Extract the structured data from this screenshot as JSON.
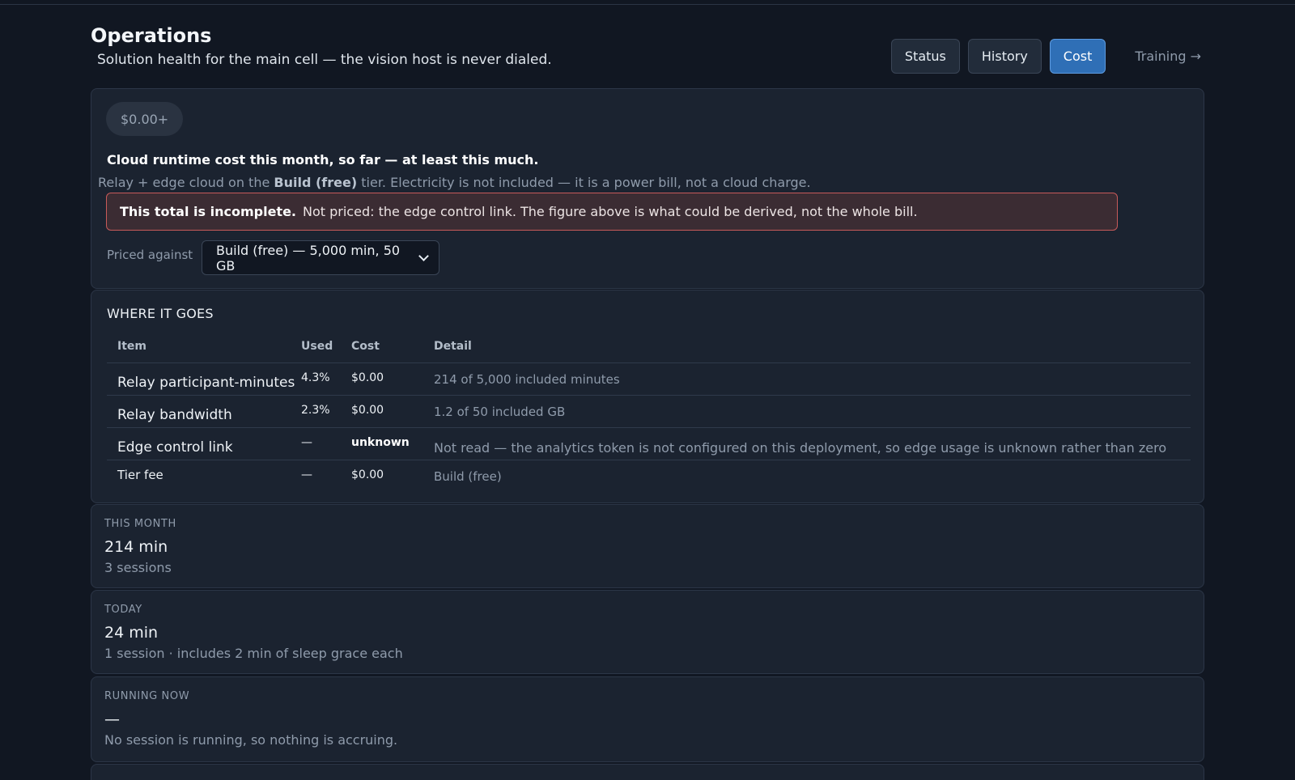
{
  "header": {
    "title": "Operations",
    "subtitle": "Solution health for the main cell — the vision host is never dialed.",
    "tabs": [
      {
        "label": "Status",
        "active": false
      },
      {
        "label": "History",
        "active": false
      },
      {
        "label": "Cost",
        "active": true
      }
    ],
    "training_link": "Training →"
  },
  "cost": {
    "badge": "$0.00+",
    "heading": "Cloud runtime cost this month, so far — at least this much.",
    "desc_prefix": "Relay + edge cloud on the ",
    "desc_tier": "Build (free)",
    "desc_suffix": " tier. Electricity is not included — it is a power bill, not a cloud charge.",
    "warning_title": "This total is incomplete.",
    "warning_text": "Not priced: the edge control link. The figure above is what could be derived, not the whole bill.",
    "priced_against_label": "Priced against",
    "priced_against_value": "Build (free) — 5,000 min, 50 GB"
  },
  "where": {
    "title": "WHERE IT GOES",
    "columns": [
      "Item",
      "Used",
      "Cost",
      "Detail"
    ],
    "rows": [
      {
        "item": "Relay participant-minutes",
        "used": "4.3%",
        "cost": "$0.00",
        "detail": "214 of 5,000 included minutes"
      },
      {
        "item": "Relay bandwidth",
        "used": "2.3%",
        "cost": "$0.00",
        "detail": "1.2 of 50 included GB"
      },
      {
        "item": "Edge control link",
        "used": "—",
        "cost": "unknown",
        "detail": "Not read — the analytics token is not configured on this deployment, so edge usage is unknown rather than zero"
      },
      {
        "item": "Tier fee",
        "used": "—",
        "cost": "$0.00",
        "detail": "Build (free)"
      }
    ]
  },
  "stats": {
    "month": {
      "label": "THIS MONTH",
      "value": "214 min",
      "sub": "3 sessions"
    },
    "today": {
      "label": "TODAY",
      "value": "24 min",
      "sub": "1 session · includes 2 min of sleep grace each"
    },
    "running": {
      "label": "RUNNING NOW",
      "value": "—",
      "sub": "No session is running, so nothing is accruing."
    }
  },
  "colors": {
    "background": "#111722",
    "card": "#1b2330",
    "accent": "#2f6fb6",
    "warning_border": "#c75a5a"
  }
}
